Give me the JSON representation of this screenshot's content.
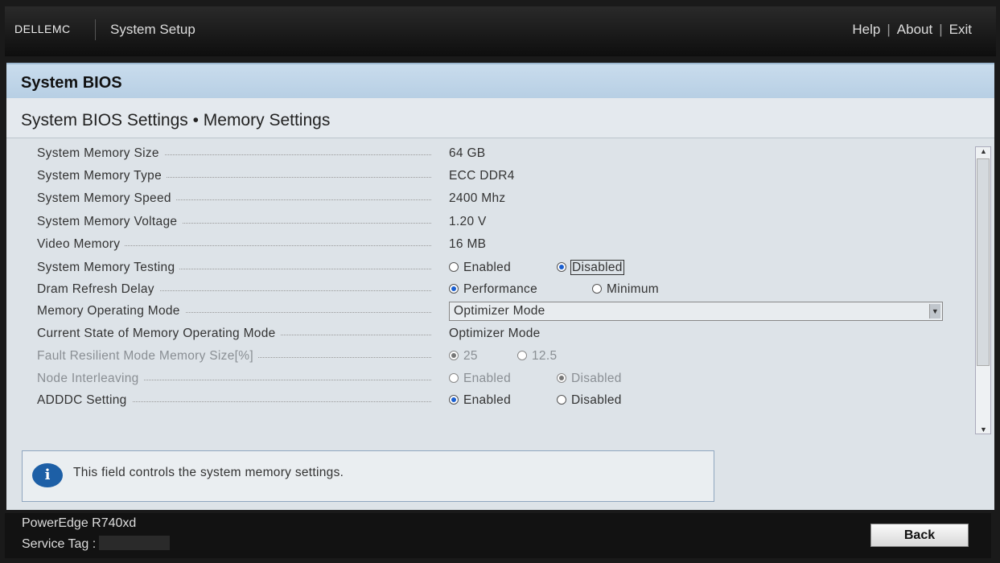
{
  "header": {
    "logo": "DELLEMC",
    "title": "System Setup",
    "links": [
      "Help",
      "About",
      "Exit"
    ]
  },
  "page": {
    "title": "System BIOS",
    "breadcrumb": "System BIOS Settings • Memory Settings"
  },
  "settings": [
    {
      "label": "System Memory Size",
      "value": "64 GB"
    },
    {
      "label": "System Memory Type",
      "value": "ECC DDR4"
    },
    {
      "label": "System Memory Speed",
      "value": "2400 Mhz"
    },
    {
      "label": "System Memory Voltage",
      "value": "1.20 V"
    },
    {
      "label": "Video Memory",
      "value": "16 MB"
    },
    {
      "label": "System Memory Testing",
      "options": [
        "Enabled",
        "Disabled"
      ],
      "selected": "Disabled"
    },
    {
      "label": "Dram Refresh Delay",
      "options": [
        "Performance",
        "Minimum"
      ],
      "selected": "Performance"
    },
    {
      "label": "Memory Operating Mode",
      "value": "Optimizer Mode"
    },
    {
      "label": "Current State of Memory Operating Mode",
      "value": "Optimizer Mode"
    },
    {
      "label": "Fault Resilient Mode Memory Size[%]",
      "options": [
        "25",
        "12.5"
      ],
      "selected": "25",
      "disabled": true
    },
    {
      "label": "Node Interleaving",
      "options": [
        "Enabled",
        "Disabled"
      ],
      "selected": "Disabled",
      "disabled": true
    },
    {
      "label": "ADDDC Setting",
      "options": [
        "Enabled",
        "Disabled"
      ],
      "selected": "Enabled"
    }
  ],
  "info": {
    "text": "This field controls the system memory settings."
  },
  "footer": {
    "model": "PowerEdge R740xd",
    "service_tag_label": "Service Tag :",
    "back": "Back"
  },
  "colors": {
    "radio_selected": "#1a5fd0",
    "header_bg": "#c9dced"
  }
}
